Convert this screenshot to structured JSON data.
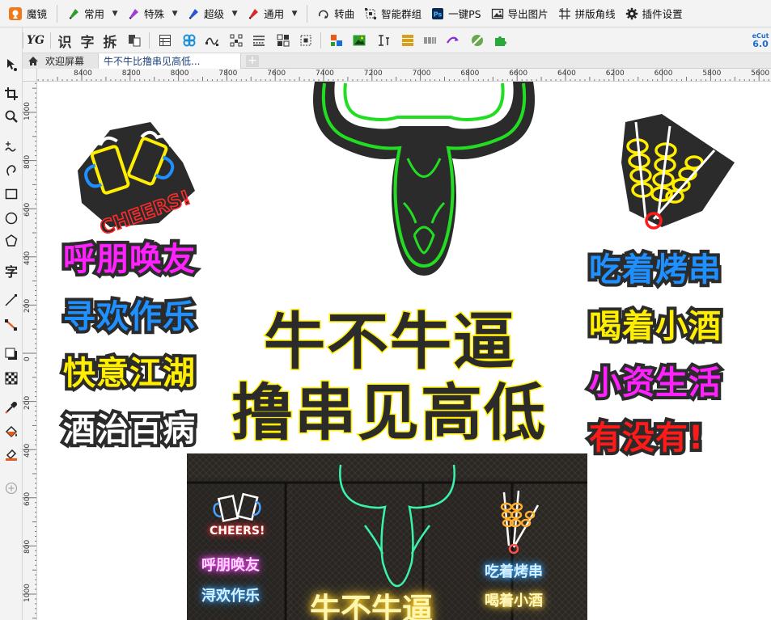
{
  "plugin_toolbar": {
    "app_name": "魔镜",
    "items": [
      {
        "label": "常用",
        "icon": "pen-nib-green-icon",
        "has_menu": true
      },
      {
        "label": "特殊",
        "icon": "pen-nib-purple-icon",
        "has_menu": true
      },
      {
        "label": "超级",
        "icon": "pen-nib-blue-icon",
        "has_menu": true
      },
      {
        "label": "通用",
        "icon": "pen-nib-red-icon",
        "has_menu": true
      },
      {
        "label": "转曲",
        "icon": "convert-curve-icon",
        "has_menu": false
      },
      {
        "label": "智能群组",
        "icon": "smart-group-icon",
        "has_menu": false
      },
      {
        "label": "一键PS",
        "icon": "photoshop-icon",
        "has_menu": false
      },
      {
        "label": "导出图片",
        "icon": "export-image-icon",
        "has_menu": false
      },
      {
        "label": "拼版角线",
        "icon": "crop-marks-icon",
        "has_menu": false
      },
      {
        "label": "插件设置",
        "icon": "gear-icon",
        "has_menu": false
      }
    ],
    "ps_badge": "Ps"
  },
  "property_toolbar": {
    "text_tools": [
      "识",
      "字",
      "拆"
    ],
    "yg_label": "YG",
    "badge_line1": "eCut",
    "badge_line2": "6.0"
  },
  "tabs": {
    "welcome": "欢迎屏幕",
    "document": "牛不牛比撸串见高低...",
    "add": "+"
  },
  "toolbox": {
    "text_tool": "字"
  },
  "rulers": {
    "horizontal": [
      "8400",
      "8200",
      "8000",
      "7800",
      "7600",
      "7400",
      "7200",
      "7000",
      "6800",
      "6600",
      "6400",
      "6200",
      "6000",
      "5800",
      "5600"
    ],
    "vertical": [
      "1000",
      "800",
      "600",
      "400",
      "200",
      "0",
      "200",
      "400",
      "600",
      "800",
      "1000"
    ]
  },
  "canvas": {
    "cheers_label": "CHEERS!",
    "left_phrases": [
      {
        "text": "呼朋唤友",
        "color": "#ff22ff"
      },
      {
        "text": "寻欢作乐",
        "color": "#1e90ff"
      },
      {
        "text": "快意江湖",
        "color": "#ffee00"
      },
      {
        "text": "酒治百病",
        "color": "#ffffff"
      }
    ],
    "right_phrases": [
      {
        "text": "吃着烤串",
        "color": "#1e90ff"
      },
      {
        "text": "喝着小酒",
        "color": "#ffee00"
      },
      {
        "text": "小资生活",
        "color": "#ff22ff"
      },
      {
        "text": "有没有!",
        "color": "#ff1a1a"
      }
    ],
    "headline_1": "牛不牛逼",
    "headline_2": "撸串见高低",
    "headline_color": "#ffee00",
    "bull_color": "#22dd22",
    "photo": {
      "cheers": "CHEERS!",
      "left_lines": [
        "呼朋唤友",
        "浔欢作乐"
      ],
      "right_lines": [
        "吃着烤串",
        "喝着小酒"
      ],
      "headline": "牛不牛逼"
    }
  }
}
